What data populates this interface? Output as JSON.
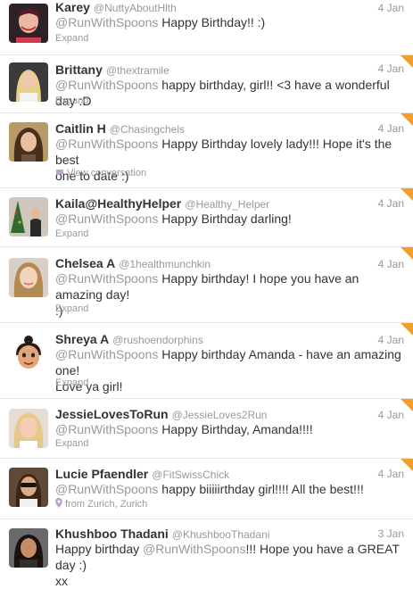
{
  "tweets": [
    {
      "name": "Karey",
      "handle": "@NuttyAboutHlth",
      "date": "4 Jan",
      "prefix": "",
      "mention": "@RunWithSpoons",
      "body": " Happy Birthday!! :)",
      "line2": "",
      "action": "Expand"
    },
    {
      "name": "Brittany",
      "handle": "@thextramile",
      "date": "4 Jan",
      "prefix": "",
      "mention": "@RunWithSpoons",
      "body": " happy birthday, girl!! <3 have a wonderful day :D",
      "line2": "",
      "action": "Expand"
    },
    {
      "name": "Caitlin H",
      "handle": "@Chasingchels",
      "date": "4 Jan",
      "prefix": "",
      "mention": "@RunWithSpoons",
      "body": " Happy Birthday lovely lady!!! Hope it's the best",
      "line2": "one to date :)",
      "action": "View conversation"
    },
    {
      "name": "Kaila@HealthyHelper",
      "handle": "@Healthy_Helper",
      "date": "4 Jan",
      "prefix": "",
      "mention": "@RunWithSpoons",
      "body": " Happy Birthday darling!",
      "line2": "",
      "action": "Expand"
    },
    {
      "name": "Chelsea A",
      "handle": "@1healthmunchkin",
      "date": "4 Jan",
      "prefix": "",
      "mention": "@RunWithSpoons",
      "body": " Happy birthday! I hope you have an amazing day!",
      "line2": ":)",
      "action": "Expand"
    },
    {
      "name": "Shreya A",
      "handle": "@rushoendorphins",
      "date": "4 Jan",
      "prefix": "",
      "mention": "@RunWithSpoons",
      "body": " Happy birthday Amanda - have an amazing one!",
      "line2": "Love ya girl!",
      "action": "Expand"
    },
    {
      "name": "JessieLovesToRun",
      "handle": "@JessieLoves2Run",
      "date": "4 Jan",
      "prefix": "",
      "mention": "@RunWithSpoons",
      "body": " Happy Birthday, Amanda!!!!",
      "line2": "",
      "action": "Expand"
    },
    {
      "name": "Lucie Pfaendler",
      "handle": "@FitSwissChick",
      "date": "4 Jan",
      "prefix": "",
      "mention": "@RunWithSpoons",
      "body": " happy biiiiirthday girl!!!! All the best!!!",
      "line2": "",
      "action": "from Zurich, Zurich"
    },
    {
      "name": "Khushboo Thadani",
      "handle": "@KhushbooThadani",
      "date": "3 Jan",
      "prefix": "Happy birthday ",
      "mention": "@RunWithSpoons",
      "body": "!!! Hope you have a GREAT day :)",
      "line2": "xx",
      "action": ""
    }
  ],
  "icons": {
    "conversation": "speech-bubble-icon",
    "location": "map-pin-icon",
    "favorite": "favorite-corner-icon"
  },
  "colors": {
    "mention": "#999999",
    "name": "#333333",
    "favorite": "#f29e2d",
    "divider": "#e8e8e8"
  }
}
